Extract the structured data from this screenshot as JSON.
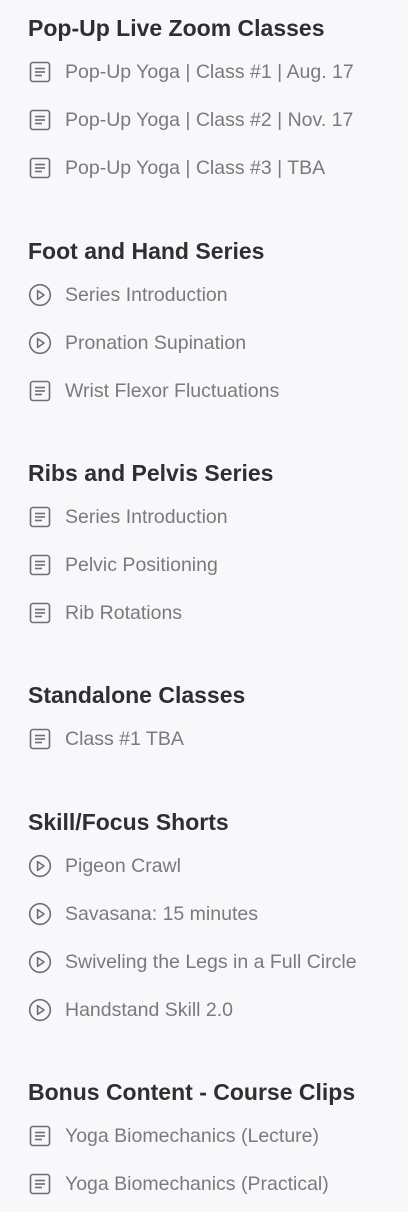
{
  "sections": [
    {
      "title": "Pop-Up Live Zoom Classes",
      "items": [
        {
          "label": "Pop-Up Yoga | Class #1 | Aug. 17",
          "icon": "document-icon"
        },
        {
          "label": "Pop-Up Yoga | Class #2 | Nov. 17",
          "icon": "document-icon"
        },
        {
          "label": "Pop-Up Yoga | Class #3 | TBA",
          "icon": "document-icon"
        }
      ]
    },
    {
      "title": "Foot and Hand Series",
      "items": [
        {
          "label": "Series Introduction",
          "icon": "play-icon"
        },
        {
          "label": "Pronation Supination",
          "icon": "play-icon"
        },
        {
          "label": "Wrist Flexor Fluctuations",
          "icon": "document-icon"
        }
      ]
    },
    {
      "title": "Ribs and Pelvis Series",
      "items": [
        {
          "label": "Series Introduction",
          "icon": "document-icon"
        },
        {
          "label": "Pelvic Positioning",
          "icon": "document-icon"
        },
        {
          "label": "Rib Rotations",
          "icon": "document-icon"
        }
      ]
    },
    {
      "title": "Standalone Classes",
      "items": [
        {
          "label": "Class #1 TBA",
          "icon": "document-icon"
        }
      ]
    },
    {
      "title": "Skill/Focus Shorts",
      "items": [
        {
          "label": "Pigeon Crawl",
          "icon": "play-icon"
        },
        {
          "label": "Savasana: 15 minutes",
          "icon": "play-icon"
        },
        {
          "label": "Swiveling the Legs in a Full Circle",
          "icon": "play-icon"
        },
        {
          "label": "Handstand Skill 2.0",
          "icon": "play-icon"
        }
      ]
    },
    {
      "title": "Bonus Content - Course Clips",
      "items": [
        {
          "label": "Yoga Biomechanics (Lecture)",
          "icon": "document-icon"
        },
        {
          "label": "Yoga Biomechanics (Practical)",
          "icon": "document-icon"
        }
      ]
    }
  ],
  "colors": {
    "background": "#f8f8fb",
    "heading": "#2f2f31",
    "item_text": "#7a7a7c",
    "icon": "#6f6f72"
  }
}
